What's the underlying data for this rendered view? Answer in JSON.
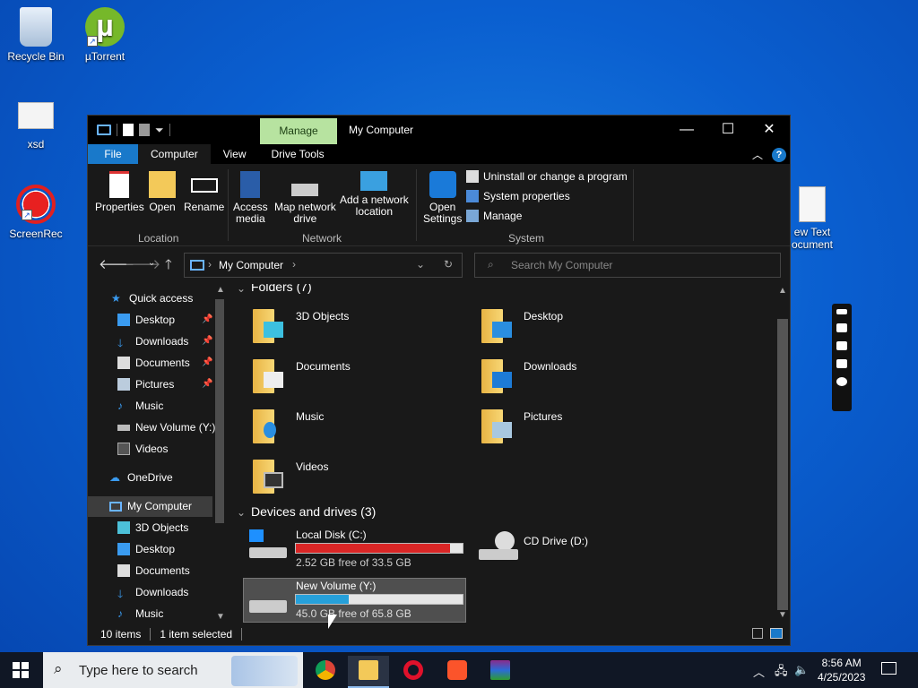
{
  "desktop": {
    "icons": [
      {
        "label": "Recycle Bin"
      },
      {
        "label": "µTorrent"
      },
      {
        "label": "xsd"
      },
      {
        "label": "ScreenRec"
      },
      {
        "label": "New Text Document"
      }
    ],
    "new_text_line1": "ew Text",
    "new_text_line2": "ocument"
  },
  "window": {
    "title": "My Computer",
    "context_tab": "Manage",
    "tabs": [
      "File",
      "Computer",
      "View",
      "Drive Tools"
    ],
    "ribbon": {
      "location": {
        "label": "Location",
        "buttons": [
          "Properties",
          "Open",
          "Rename"
        ]
      },
      "network": {
        "label": "Network",
        "access_media_1": "Access",
        "access_media_2": "media",
        "map_drive_1": "Map network",
        "map_drive_2": "drive",
        "add_location_1": "Add a network",
        "add_location_2": "location"
      },
      "system": {
        "label": "System",
        "open_settings_1": "Open",
        "open_settings_2": "Settings",
        "items": [
          "Uninstall or change a program",
          "System properties",
          "Manage"
        ]
      }
    },
    "address": {
      "path": "My Computer",
      "search_placeholder": "Search My Computer"
    },
    "sidebar": {
      "quick_access": "Quick access",
      "quick_items": [
        "Desktop",
        "Downloads",
        "Documents",
        "Pictures",
        "Music",
        "New Volume (Y:)",
        "Videos"
      ],
      "onedrive": "OneDrive",
      "my_computer": "My Computer",
      "pc_items": [
        "3D Objects",
        "Desktop",
        "Documents",
        "Downloads",
        "Music"
      ]
    },
    "content": {
      "folders_header": "Folders (7)",
      "folders": [
        "3D Objects",
        "Desktop",
        "Documents",
        "Downloads",
        "Music",
        "Pictures",
        "Videos"
      ],
      "drives_header": "Devices and drives (3)",
      "drives": [
        {
          "name": "Local Disk (C:)",
          "free": "2.52 GB free of 33.5 GB",
          "used_fraction": 0.925,
          "bar_color": "#da2626"
        },
        {
          "name": "CD Drive (D:)"
        },
        {
          "name": "New Volume (Y:)",
          "free": "45.0 GB free of 65.8 GB",
          "used_fraction": 0.316,
          "bar_color": "#26a0da"
        }
      ]
    },
    "status": {
      "items": "10 items",
      "selected": "1 item selected"
    }
  },
  "taskbar": {
    "search_placeholder": "Type here to search",
    "time": "8:56 AM",
    "date": "4/25/2023"
  },
  "colors": {
    "accent": "#1979ca",
    "manage_tab": "#b7e3a0",
    "folder": "#f3c959"
  }
}
